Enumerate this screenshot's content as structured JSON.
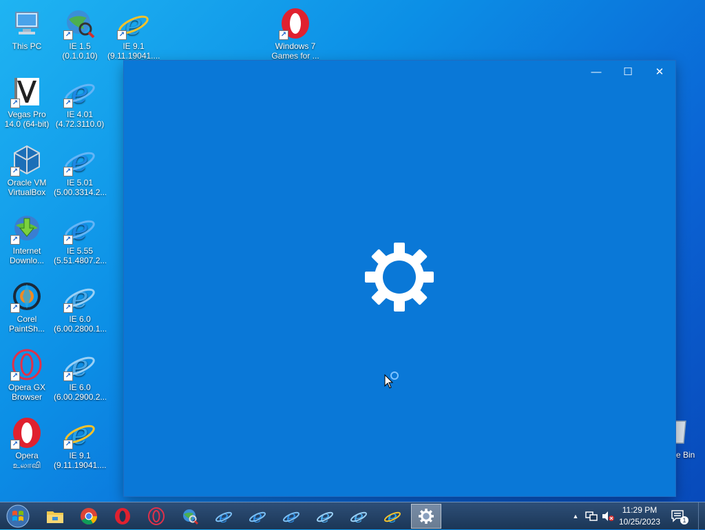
{
  "desktop": {
    "icons": [
      {
        "label": "This PC",
        "icon": "computer-icon"
      },
      {
        "label": "IE 1.5\n(0.1.0.10)",
        "icon": "ie-globe-icon"
      },
      {
        "label": "IE 9.1\n(9.11.19041....",
        "icon": "ie-icon"
      },
      {
        "label": "Windows 7\nGames for ...",
        "icon": "opera-icon"
      },
      {
        "label": "Vegas Pro\n14.0 (64-bit)",
        "icon": "vegas-icon"
      },
      {
        "label": "IE 4.01\n(4.72.3110.0)",
        "icon": "ie-icon"
      },
      {
        "label": "Oracle VM\nVirtualBox",
        "icon": "virtualbox-icon"
      },
      {
        "label": "IE 5.01\n(5.00.3314.2...",
        "icon": "ie-icon"
      },
      {
        "label": "Internet\nDownlo...",
        "icon": "download-manager-icon"
      },
      {
        "label": "IE 5.55\n(5.51.4807.2...",
        "icon": "ie-icon"
      },
      {
        "label": "Corel\nPaintSh...",
        "icon": "corel-icon"
      },
      {
        "label": "IE 6.0\n(6.00.2800.1...",
        "icon": "ie-icon"
      },
      {
        "label": "Opera GX\nBrowser",
        "icon": "opera-gx-icon"
      },
      {
        "label": "IE 6.0\n(6.00.2900.2...",
        "icon": "ie-icon"
      },
      {
        "label": "Opera\nஉலாவி",
        "icon": "opera-icon"
      },
      {
        "label": "IE 9.1\n(9.11.19041....",
        "icon": "ie-icon"
      }
    ],
    "recycle_bin_label": "e Bin"
  },
  "window": {
    "state": "loading",
    "minimize": "—",
    "maximize": "☐",
    "close": "✕",
    "icon": "gear-icon"
  },
  "taskbar": {
    "items": [
      "file-explorer-icon",
      "chrome-icon",
      "opera-icon",
      "opera-gx-icon",
      "ie-globe-icon",
      "ie-icon",
      "ie-icon",
      "ie-icon",
      "ie-icon",
      "ie-icon",
      "ie-icon",
      "settings-icon"
    ],
    "tray_chevron": "▲",
    "time": "11:29 PM",
    "date": "10/25/2023",
    "notification_count": "1"
  },
  "colors": {
    "window_bg": "#0a78d7",
    "taskbar": "#1b3656"
  }
}
